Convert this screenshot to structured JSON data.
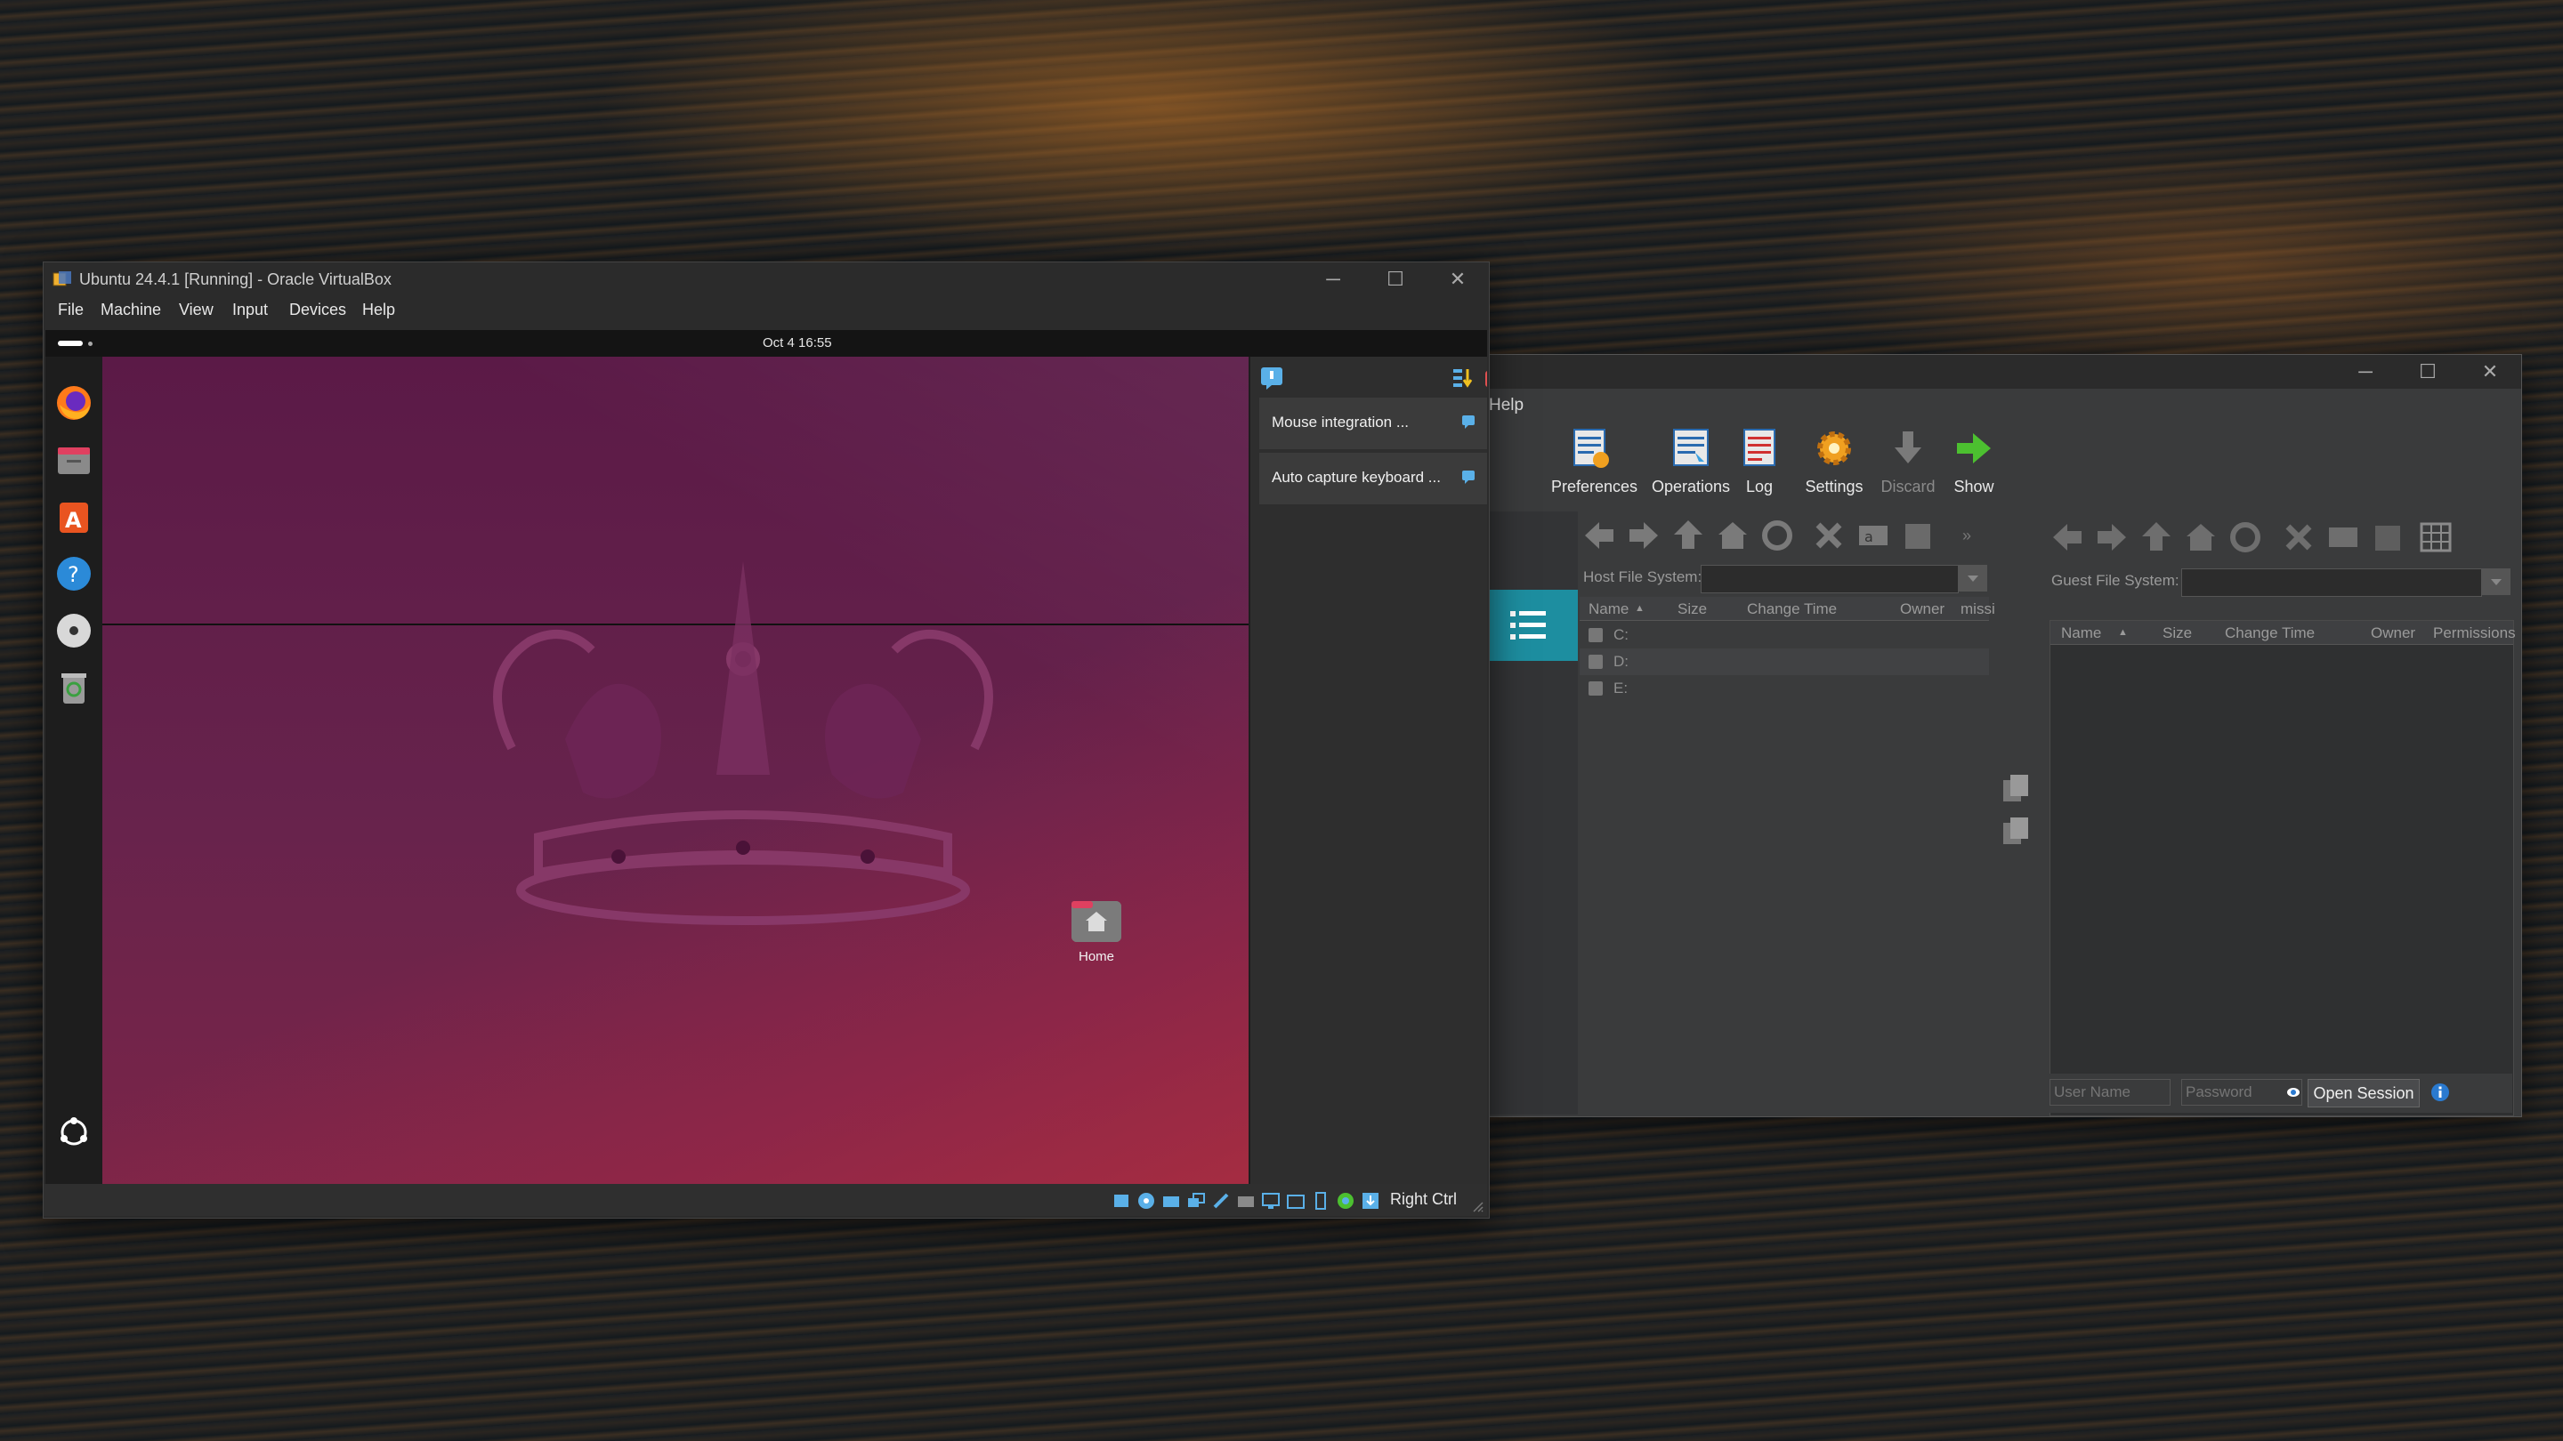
{
  "file_manager": {
    "menu_help": "Help",
    "toolbar": {
      "preferences": "Preferences",
      "operations": "Operations",
      "log": "Log",
      "settings": "Settings",
      "discard": "Discard",
      "show": "Show"
    },
    "host": {
      "label": "Host File System:",
      "columns": [
        "Name",
        "Size",
        "Change Time",
        "Owner",
        "missi"
      ],
      "drives": [
        "C:",
        "D:",
        "E:"
      ]
    },
    "guest": {
      "label": "Guest File System:",
      "columns": [
        "Name",
        "Size",
        "Change Time",
        "Owner",
        "Permissions"
      ],
      "username_placeholder": "User Name",
      "password_placeholder": "Password",
      "open_session": "Open Session"
    }
  },
  "vbox": {
    "title": "Ubuntu 24.4.1 [Running] - Oracle VirtualBox",
    "menu": [
      "File",
      "Machine",
      "View",
      "Input",
      "Devices",
      "Help"
    ],
    "guest": {
      "clock": "Oct 4  16:55",
      "home_label": "Home",
      "notifications": [
        "Mouse integration ...",
        "Auto capture keyboard ..."
      ]
    },
    "statusbar": {
      "host_key": "Right Ctrl"
    }
  },
  "colors": {
    "accent": "#1d8ea0",
    "ubuntu_orange": "#e95420"
  }
}
